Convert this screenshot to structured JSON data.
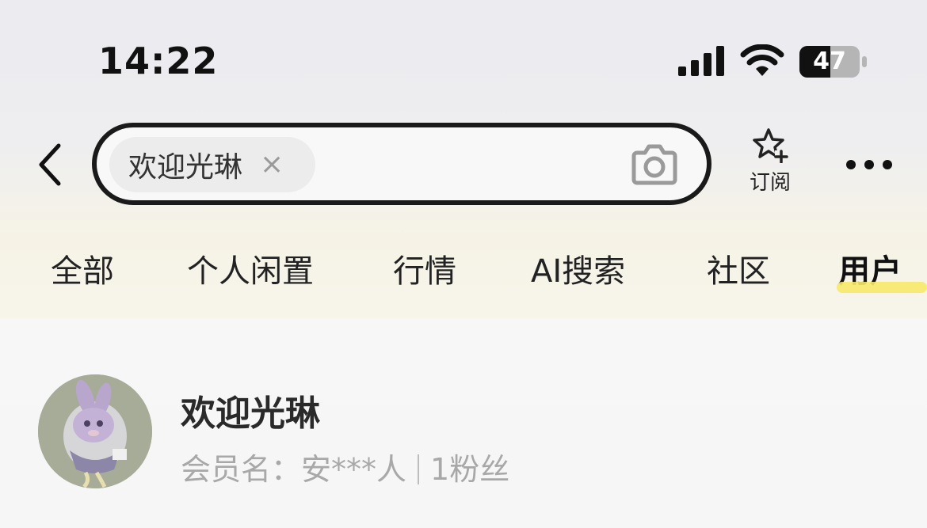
{
  "status_bar": {
    "time": "14:22",
    "battery_level": "47"
  },
  "search": {
    "query": "欢迎光琳",
    "clear_icon": "×"
  },
  "header": {
    "subscribe_label": "订阅"
  },
  "tabs": [
    {
      "label": "全部",
      "active": false
    },
    {
      "label": "个人闲置",
      "active": false
    },
    {
      "label": "行情",
      "active": false
    },
    {
      "label": "AI搜索",
      "active": false
    },
    {
      "label": "社区",
      "active": false
    },
    {
      "label": "用户",
      "active": true
    }
  ],
  "result": {
    "user_name": "欢迎光琳",
    "member_prefix": "会员名：",
    "member_name": "安***人",
    "fans": "1粉丝"
  },
  "colors": {
    "accent_highlight": "#f7e96a",
    "muted_text": "#a8a8a8"
  }
}
